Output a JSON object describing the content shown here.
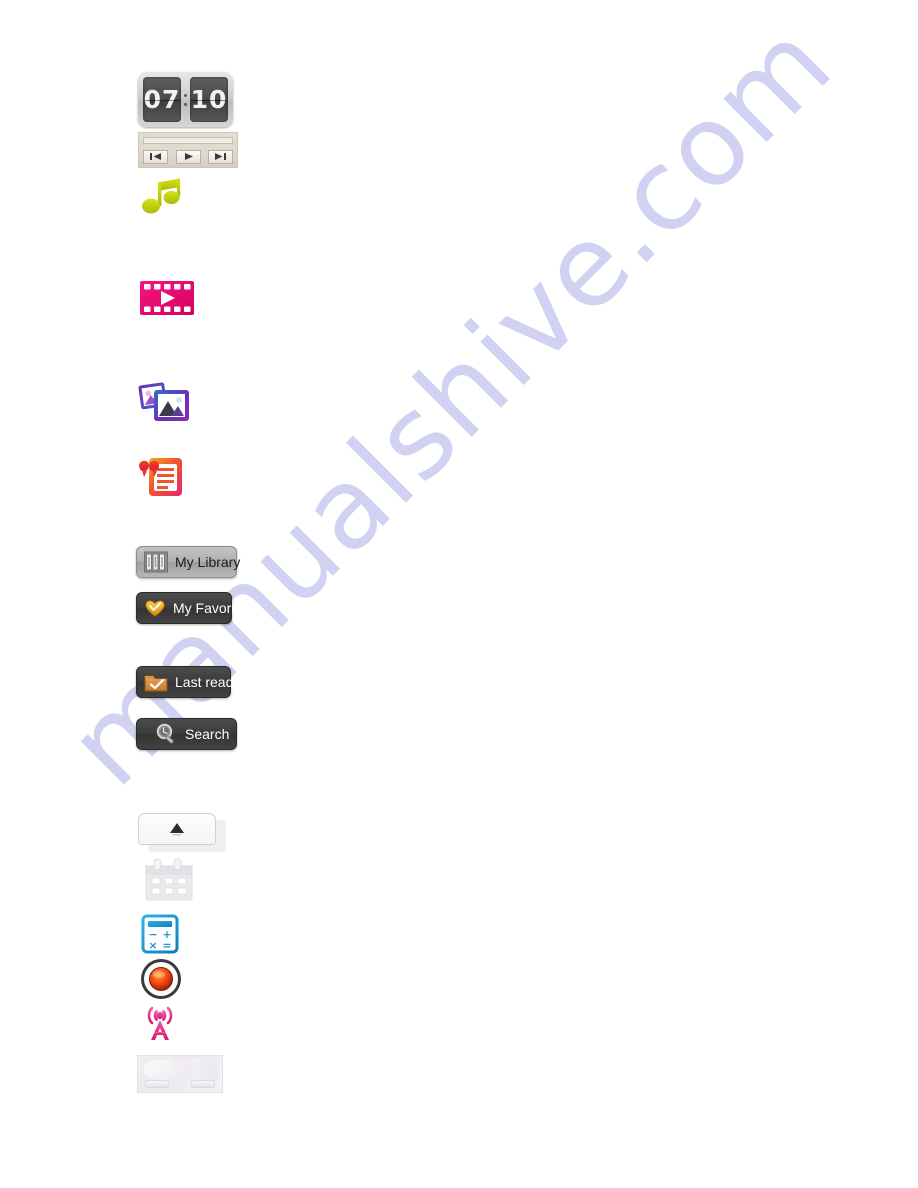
{
  "page": {
    "watermark_text": "manualshive.com",
    "watermark_color": "#c9cbf0",
    "background_color": "#ffffff"
  },
  "clock_widget": {
    "name": "flip-clock",
    "hours": "07",
    "minutes": "10",
    "separator": ":",
    "body_color": "#cfcfcf",
    "pane_color": "#4a4a4a",
    "digit_color": "#f2f2f2"
  },
  "transport_bar": {
    "name": "media-transport-bar",
    "background_color": "#ded8cd",
    "buttons": [
      {
        "name": "previous-button",
        "icon": "skip-previous-icon"
      },
      {
        "name": "play-button",
        "icon": "play-icon"
      },
      {
        "name": "next-button",
        "icon": "skip-next-icon"
      }
    ]
  },
  "media_icons": [
    {
      "name": "music-icon",
      "icon": "music-note-icon",
      "color": "#c3d417"
    },
    {
      "name": "video-icon",
      "icon": "film-strip-icon",
      "color": "#ec0a6e"
    },
    {
      "name": "photo-icon",
      "icon": "photo-stack-icon",
      "color": "#7b2fbe"
    },
    {
      "name": "text-icon",
      "icon": "ebook-quote-icon",
      "color": "#f05a28"
    }
  ],
  "library_buttons": [
    {
      "name": "my-library-button",
      "label": "My Library",
      "icon": "books-shelf-icon",
      "style": "light",
      "bg": "#b0b0b0",
      "fg": "#1d1d1d"
    },
    {
      "name": "my-favorite-button",
      "label": "My Favorite",
      "icon": "heart-icon",
      "style": "dark",
      "bg": "#3b3b3b",
      "fg": "#ffffff"
    },
    {
      "name": "last-read-button",
      "label": "Last read",
      "icon": "folder-check-icon",
      "style": "dark",
      "bg": "#3b3b3b",
      "fg": "#ffffff"
    },
    {
      "name": "search-button",
      "label": "Search",
      "icon": "magnifier-icon",
      "style": "dark",
      "bg": "#3b3b3b",
      "fg": "#ffffff"
    }
  ],
  "expander": {
    "name": "expander-panel",
    "icon": "triangle-up-icon",
    "background_color": "#f4f4f4"
  },
  "utility_icons": [
    {
      "name": "calendar-icon",
      "icon": "calendar-icon",
      "color": "#e8e8ea"
    },
    {
      "name": "calculator-icon",
      "icon": "calculator-icon",
      "color": "#1b9ad6"
    },
    {
      "name": "record-icon",
      "icon": "record-button-icon",
      "color": "#e03a10"
    },
    {
      "name": "fm-radio-icon",
      "icon": "radio-broadcast-icon",
      "color": "#e8348f"
    }
  ],
  "thumbnail_panel": {
    "name": "photo-thumbnail-panel",
    "background_color": "#eceef2"
  }
}
